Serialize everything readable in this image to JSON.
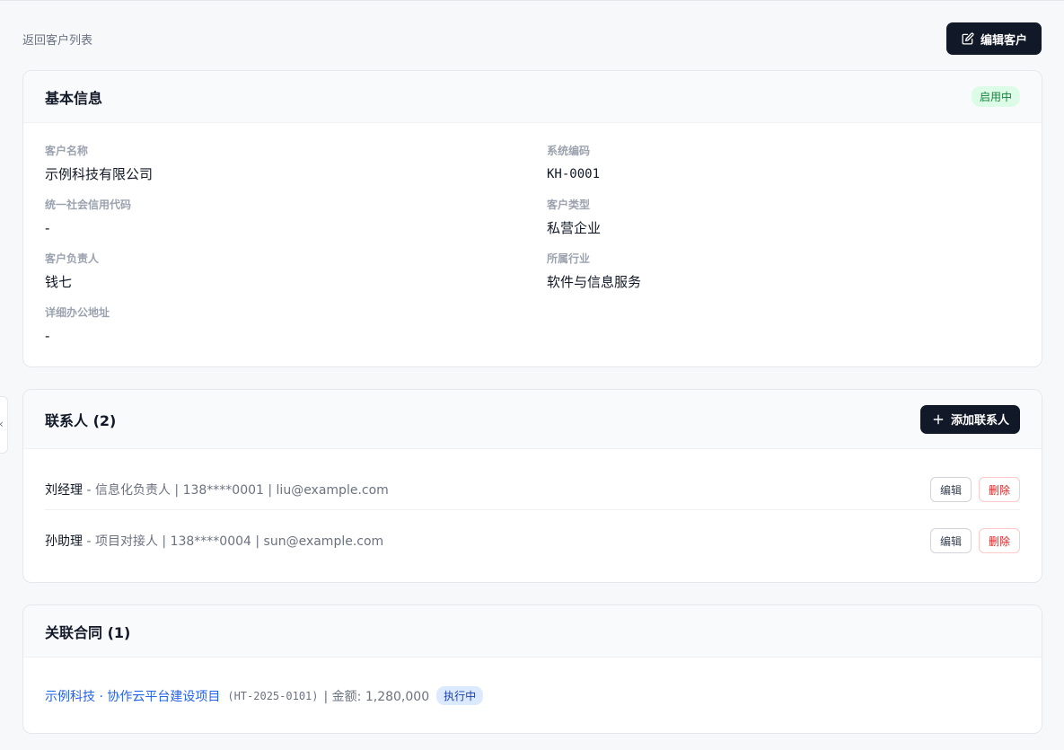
{
  "top": {
    "back_label": "返回客户列表",
    "edit_customer_label": "编辑客户"
  },
  "basic_info": {
    "title": "基本信息",
    "status": "启用中",
    "fields": {
      "customer_name": {
        "label": "客户名称",
        "value": "示例科技有限公司"
      },
      "system_code": {
        "label": "系统编码",
        "value": "KH-0001"
      },
      "credit_code": {
        "label": "统一社会信用代码",
        "value": "-"
      },
      "customer_type": {
        "label": "客户类型",
        "value": "私营企业"
      },
      "owner": {
        "label": "客户负责人",
        "value": "钱七"
      },
      "industry": {
        "label": "所属行业",
        "value": "软件与信息服务"
      },
      "address": {
        "label": "详细办公地址",
        "value": "-"
      }
    }
  },
  "contacts": {
    "title": "联系人 (2)",
    "add_label": "添加联系人",
    "edit_label": "编辑",
    "delete_label": "删除",
    "items": [
      {
        "name": "刘经理",
        "detail": " - 信息化负责人 | 138****0001 | liu@example.com"
      },
      {
        "name": "孙助理",
        "detail": " - 项目对接人 | 138****0004 | sun@example.com"
      }
    ]
  },
  "contracts": {
    "title": "关联合同 (1)",
    "items": [
      {
        "name": "示例科技 · 协作云平台建设项目",
        "code": "(HT-2025-0101)",
        "amount": "| 金额: 1,280,000",
        "status": "执行中"
      }
    ]
  }
}
